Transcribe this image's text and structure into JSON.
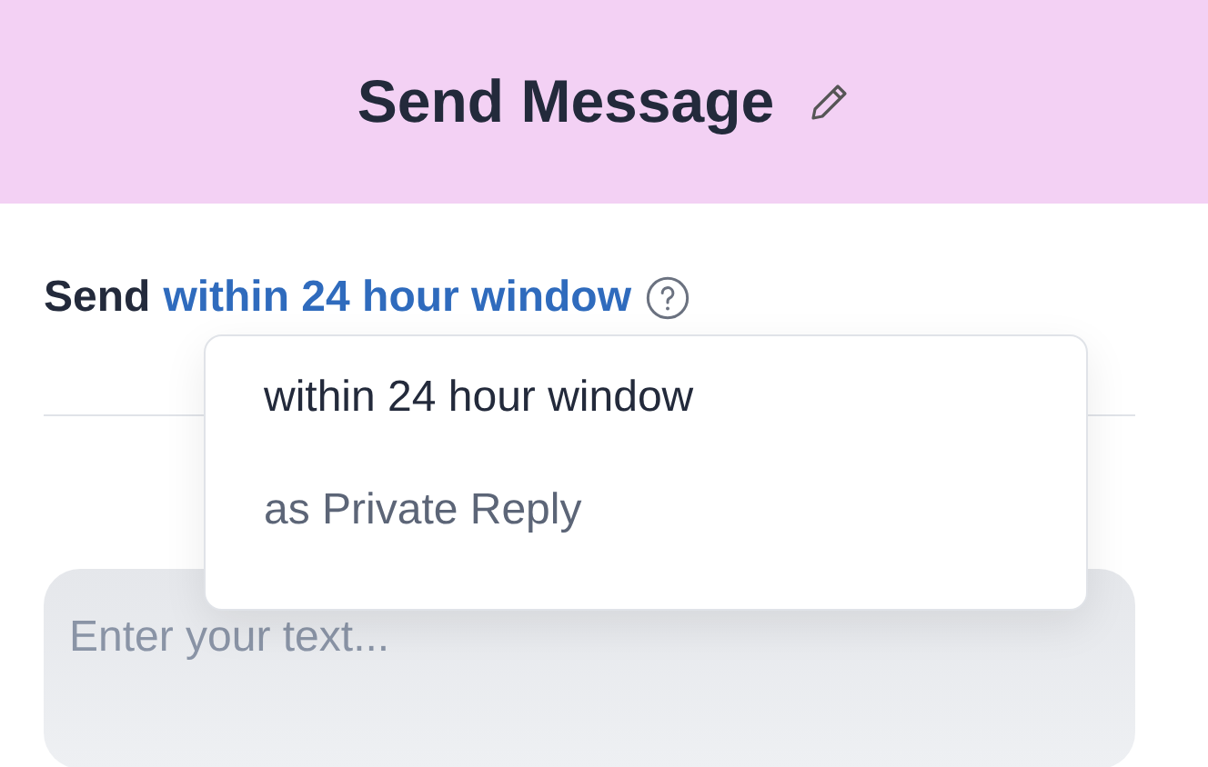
{
  "header": {
    "title": "Send Message"
  },
  "send_line": {
    "label": "Send",
    "mode": "within 24 hour window"
  },
  "dropdown": {
    "open": true,
    "options": [
      {
        "label": "within 24 hour window",
        "selected": true
      },
      {
        "label": "as Private Reply",
        "selected": false
      }
    ]
  },
  "message": {
    "placeholder": "Enter your text..."
  }
}
